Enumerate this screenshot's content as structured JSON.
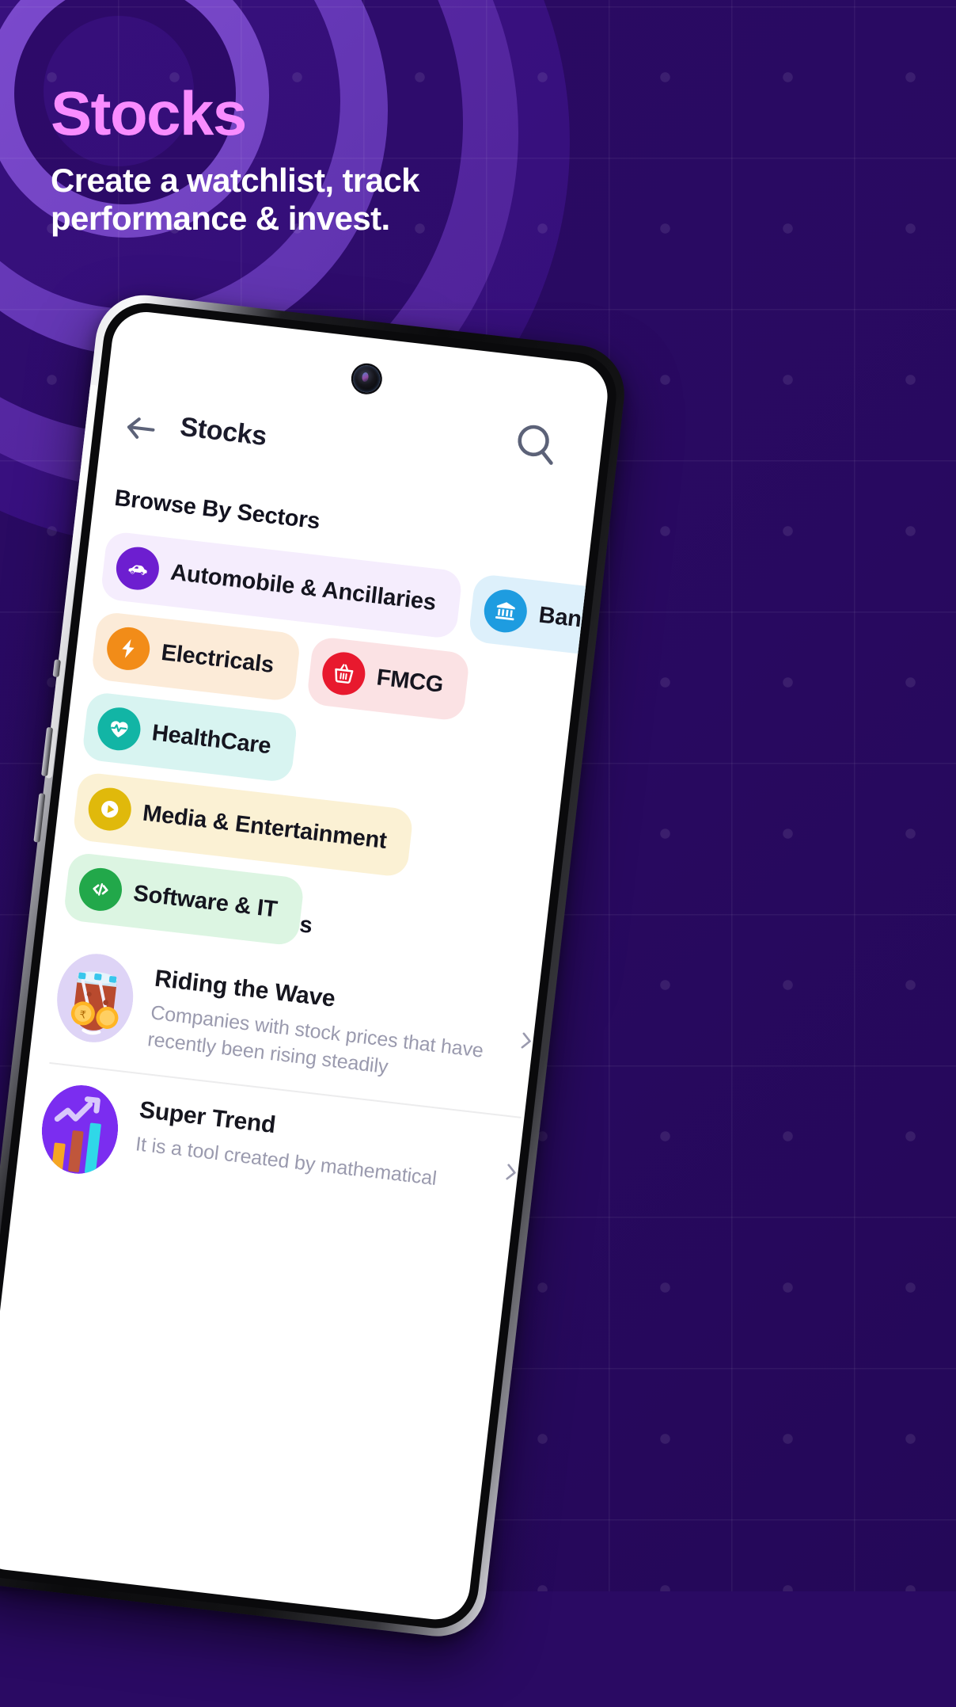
{
  "hero": {
    "title": "Stocks",
    "title_color": "#f98cff",
    "subtitle": "Create a watchlist, track performance & invest.",
    "subtitle_color": "#ffffff",
    "background_color": "#2a0a63"
  },
  "phone": {
    "app": {
      "back_icon": "back-arrow-icon",
      "title": "Stocks",
      "search_icon": "search-icon",
      "sections": {
        "sectors_heading": "Browse By Sectors",
        "collections_heading": "Browse By Collections"
      },
      "sectors": [
        {
          "label": "Automobile & Ancillaries",
          "icon": "car-icon",
          "icon_bg": "#6d1ed0",
          "chip_bg": "#f5edfd"
        },
        {
          "label": "Banks",
          "icon": "bank-icon",
          "icon_bg": "#1e9ce0",
          "chip_bg": "#ddf0fb"
        },
        {
          "label": "Electricals",
          "icon": "bolt-icon",
          "icon_bg": "#f28c18",
          "chip_bg": "#fcebd8"
        },
        {
          "label": "FMCG",
          "icon": "basket-icon",
          "icon_bg": "#e8192e",
          "chip_bg": "#fbe2e4"
        },
        {
          "label": "HealthCare",
          "icon": "heart-pulse-icon",
          "icon_bg": "#12b5a5",
          "chip_bg": "#d8f4f1"
        },
        {
          "label": "Media & Entertainment",
          "icon": "play-icon",
          "icon_bg": "#e0b90b",
          "chip_bg": "#fbf1d4"
        },
        {
          "label": "Software & IT",
          "icon": "code-icon",
          "icon_bg": "#22a84a",
          "chip_bg": "#dcf5e2"
        }
      ],
      "collections": [
        {
          "title": "Riding the Wave",
          "description": "Companies with stock prices that have recently been rising steadily",
          "art": "coins-jar-illustration",
          "chevron": "chevron-right-icon"
        },
        {
          "title": "Super Trend",
          "description": "It is a tool created by mathematical",
          "art": "growth-chart-illustration",
          "chevron": "chevron-right-icon"
        }
      ]
    }
  }
}
